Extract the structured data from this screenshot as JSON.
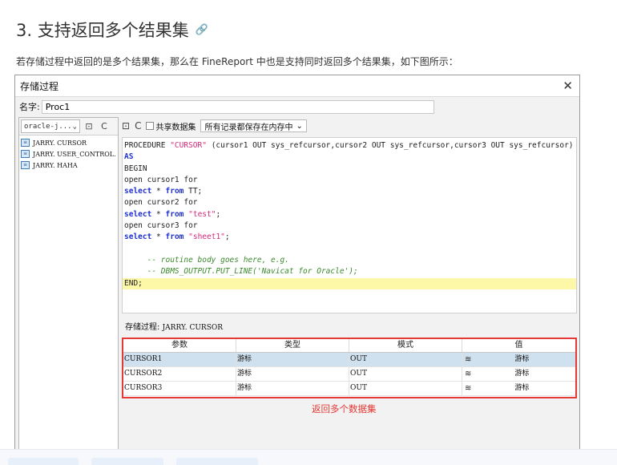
{
  "doc": {
    "title": "3. 支持返回多个结果集",
    "intro": "若存储过程中返回的是多个结果集，那么在 FineReport 中也是支持同时返回多个结果集，如下图所示："
  },
  "dialog": {
    "title": "存储过程",
    "name_label": "名字:",
    "name_value": "Proc1",
    "db_select": "oracle-j...",
    "procedures": [
      "JARRY. CURSOR",
      "JARRY. USER_CONTROL. USE",
      "JARRY. HAHA"
    ],
    "share_label": "共享数据集",
    "memory_option": "所有记录都保存在内存中",
    "code": [
      [
        {
          "t": "PROCEDURE "
        },
        {
          "t": "\"CURSOR\"",
          "c": "str"
        },
        {
          "t": " (cursor1 OUT sys_refcursor,cursor2 OUT sys_refcursor,cursor3 OUT sys_refcursor)"
        }
      ],
      [
        {
          "t": "AS",
          "c": "kw"
        }
      ],
      [
        {
          "t": "BEGIN"
        }
      ],
      [
        {
          "t": "open cursor1 for"
        }
      ],
      [
        {
          "t": "select",
          "c": "kw"
        },
        {
          "t": " * "
        },
        {
          "t": "from",
          "c": "kw"
        },
        {
          "t": " TT;"
        }
      ],
      [
        {
          "t": "open cursor2 for"
        }
      ],
      [
        {
          "t": "select",
          "c": "kw"
        },
        {
          "t": " * "
        },
        {
          "t": "from",
          "c": "kw"
        },
        {
          "t": " "
        },
        {
          "t": "\"test\"",
          "c": "str"
        },
        {
          "t": ";"
        }
      ],
      [
        {
          "t": "open cursor3 for"
        }
      ],
      [
        {
          "t": "select",
          "c": "kw"
        },
        {
          "t": " * "
        },
        {
          "t": "from",
          "c": "kw"
        },
        {
          "t": " "
        },
        {
          "t": "\"sheet1\"",
          "c": "str"
        },
        {
          "t": ";"
        }
      ],
      [
        {
          "t": ""
        }
      ],
      [
        {
          "t": "     -- routine body goes here, e.g.",
          "c": "cmt"
        }
      ],
      [
        {
          "t": "     -- DBMS_OUTPUT.PUT_LINE('Navicat for Oracle');",
          "c": "cmt"
        }
      ],
      [
        {
          "t": "END;",
          "hl": true
        }
      ]
    ],
    "sp_label": "存储过程:",
    "sp_value": "JARRY. CURSOR",
    "param_headers": [
      "参数",
      "类型",
      "模式",
      "值"
    ],
    "param_rows": [
      {
        "name": "CURSOR1",
        "type": "游标",
        "mode": "OUT",
        "value": "游标"
      },
      {
        "name": "CURSOR2",
        "type": "游标",
        "mode": "OUT",
        "value": "游标"
      },
      {
        "name": "CURSOR3",
        "type": "游标",
        "mode": "OUT",
        "value": "游标"
      }
    ],
    "annotation": "返回多个数据集"
  },
  "icons": {
    "link": "🔗",
    "close": "✕",
    "dropdown": "⌄",
    "refresh": "C",
    "edit": "⊡",
    "database": "≋"
  }
}
